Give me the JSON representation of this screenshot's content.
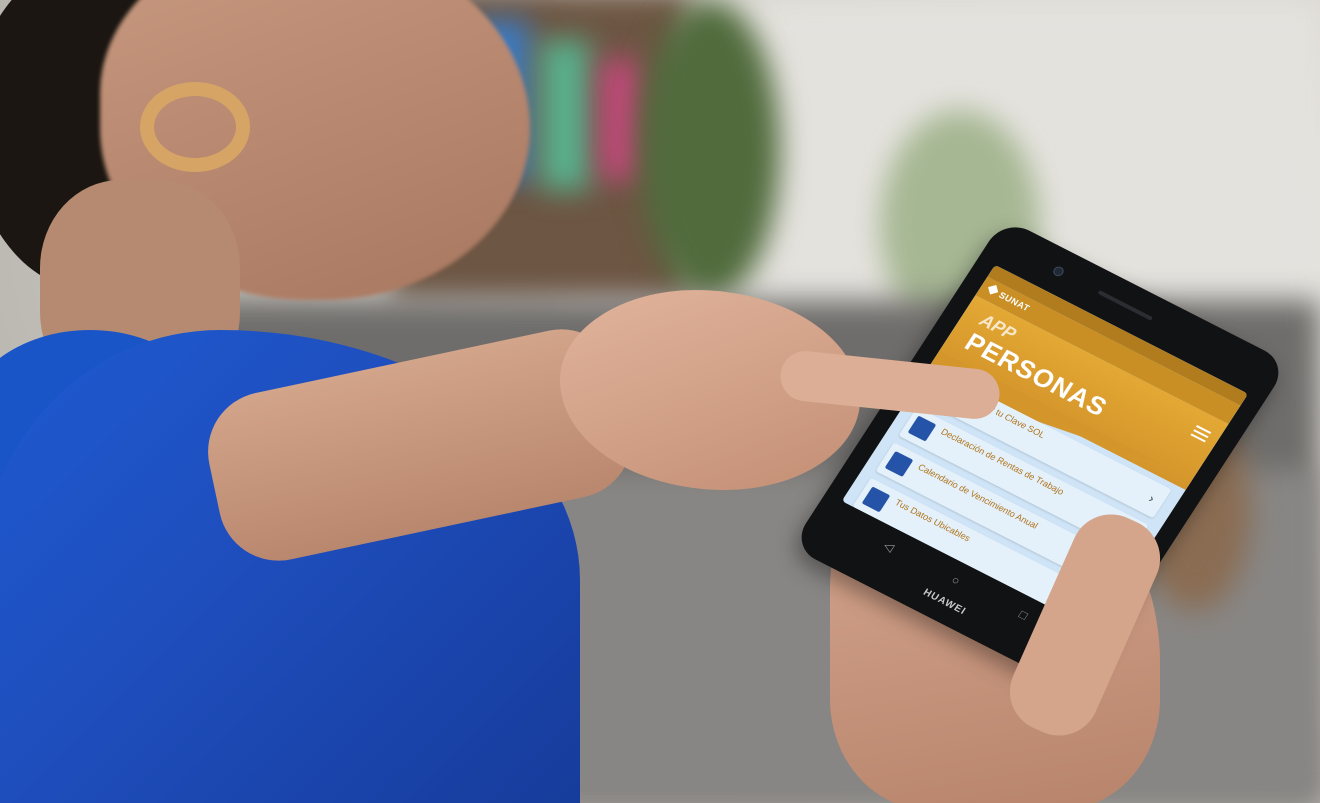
{
  "scene": {
    "description_tag": "woman using smartphone app"
  },
  "phone": {
    "brand": "HUAWEI",
    "status_time": "",
    "app": {
      "logo_text": "SUNAT",
      "hero_title_line1": "APP",
      "hero_title_line2": "PERSONAS",
      "menu_items": [
        {
          "label": "Generar tu Clave SOL",
          "icon": "document-icon"
        },
        {
          "label": "Declaración de Rentas de Trabajo",
          "icon": "folder-icon"
        },
        {
          "label": "Calendario de Vencimiento Anual",
          "icon": "calendar-icon"
        },
        {
          "label": "Tus Datos Ubicables",
          "icon": "location-icon"
        }
      ]
    },
    "navbar": {
      "back": "◁",
      "home": "○",
      "recent": "□"
    }
  },
  "colors": {
    "app_orange": "#d4952a",
    "screen_blue": "#cfe5f7",
    "shirt_blue": "#1d5bd1"
  }
}
